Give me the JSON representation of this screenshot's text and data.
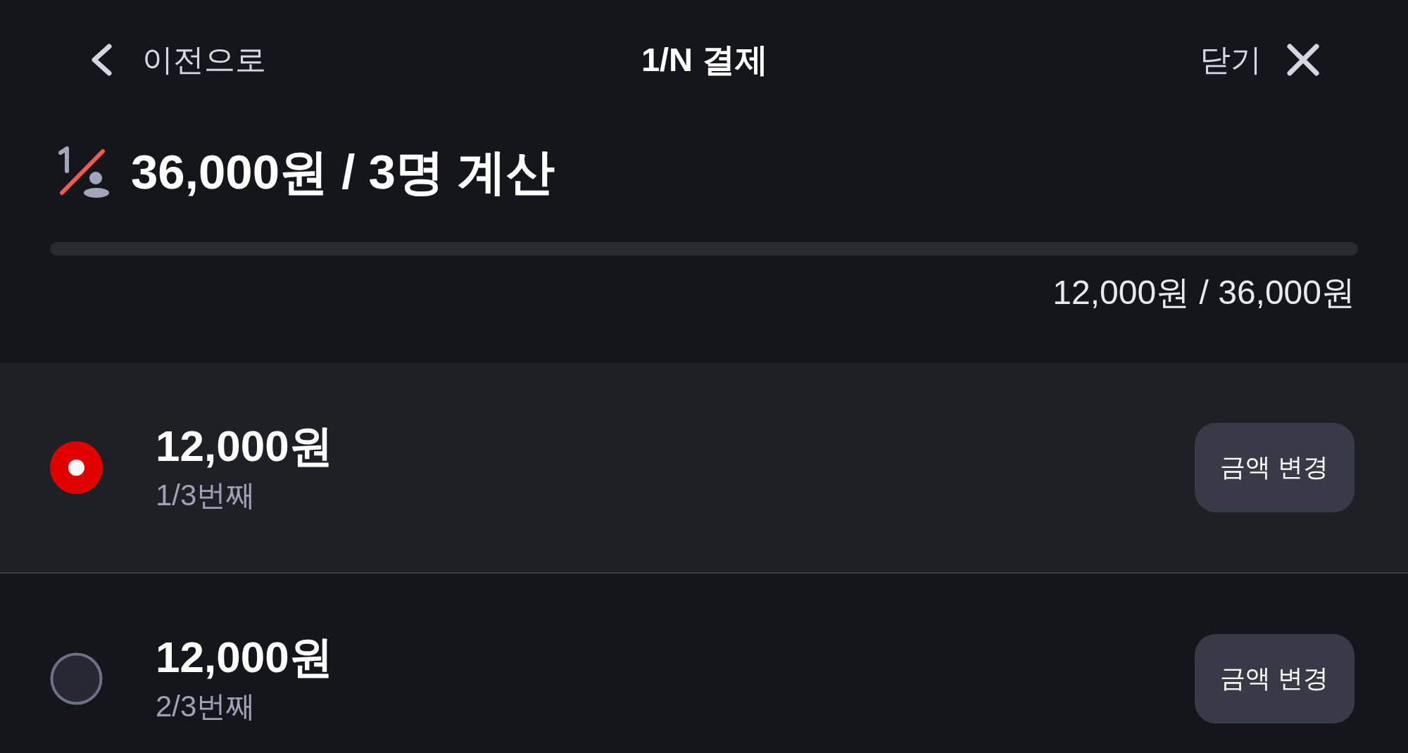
{
  "header": {
    "back": {
      "label": "이전으로"
    },
    "title": "1/N 결제",
    "close": {
      "label": "닫기"
    }
  },
  "summary": {
    "title": "36,000원 / 3명 계산",
    "progress": {
      "level": 0
    },
    "reading": "12,000원 / 36,000원"
  },
  "payers": [
    {
      "amount": "12,000원",
      "order": "1/3번째",
      "selected": true,
      "button": "금액 변경"
    },
    {
      "amount": "12,000원",
      "order": "2/3번째",
      "selected": false,
      "button": "금액 변경"
    }
  ]
}
